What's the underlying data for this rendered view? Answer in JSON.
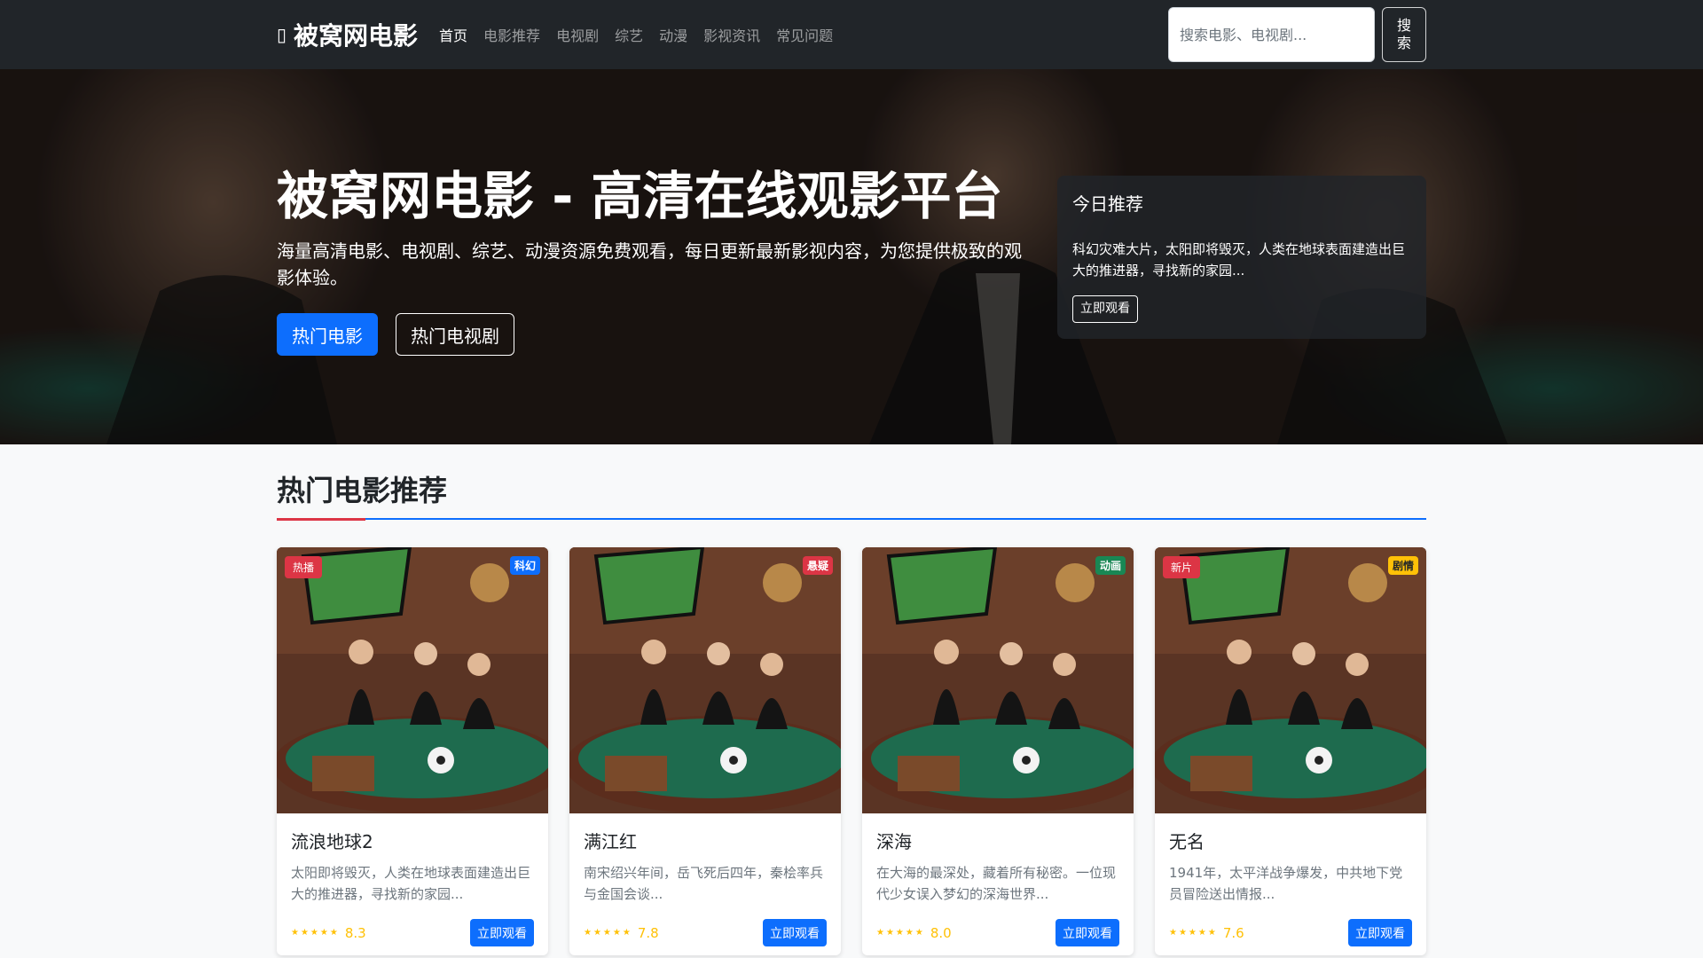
{
  "nav": {
    "brand_icon": "film-icon",
    "brand": "被窝网电影",
    "links": [
      {
        "label": "首页",
        "active": true
      },
      {
        "label": "电影推荐",
        "active": false
      },
      {
        "label": "电视剧",
        "active": false
      },
      {
        "label": "综艺",
        "active": false
      },
      {
        "label": "动漫",
        "active": false
      },
      {
        "label": "影视资讯",
        "active": false
      },
      {
        "label": "常见问题",
        "active": false
      }
    ],
    "search_placeholder": "搜索电影、电视剧...",
    "search_button": "搜索"
  },
  "hero": {
    "title": "被窝网电影 - 高清在线观影平台",
    "subtitle": "海量高清电影、电视剧、综艺、动漫资源免费观看，每日更新最新影视内容，为您提供极致的观影体验。",
    "btn_movies": "热门电影",
    "btn_tv": "热门电视剧",
    "today": {
      "title": "今日推荐",
      "desc": "科幻灾难大片，太阳即将毁灭，人类在地球表面建造出巨大的推进器，寻找新的家园...",
      "button": "立即观看"
    }
  },
  "section": {
    "title": "热门电影推荐"
  },
  "cards": [
    {
      "badge_left": "热播",
      "badge_right": "科幻",
      "badge_right_color": "#0d6efd",
      "title": "流浪地球2",
      "desc": "太阳即将毁灭，人类在地球表面建造出巨大的推进器，寻找新的家园...",
      "stars": "★★★★★",
      "rating": "8.3",
      "button": "立即观看"
    },
    {
      "badge_left": "",
      "badge_right": "悬疑",
      "badge_right_color": "#dc3545",
      "title": "满江红",
      "desc": "南宋绍兴年间，岳飞死后四年，秦桧率兵与金国会谈...",
      "stars": "★★★★★",
      "rating": "7.8",
      "button": "立即观看"
    },
    {
      "badge_left": "",
      "badge_right": "动画",
      "badge_right_color": "#198754",
      "title": "深海",
      "desc": "在大海的最深处，藏着所有秘密。一位现代少女误入梦幻的深海世界...",
      "stars": "★★★★★",
      "rating": "8.0",
      "button": "立即观看"
    },
    {
      "badge_left": "新片",
      "badge_right": "剧情",
      "badge_right_color": "#ffc107",
      "title": "无名",
      "desc": "1941年，太平洋战争爆发，中共地下党员冒险送出情报...",
      "stars": "★★★★★",
      "rating": "7.6",
      "button": "立即观看"
    }
  ]
}
